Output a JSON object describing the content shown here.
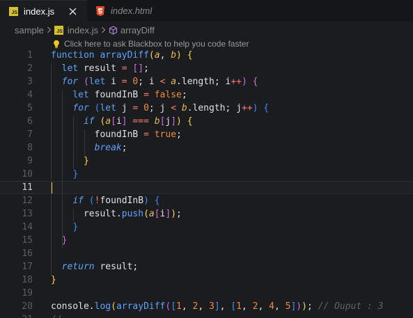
{
  "tabs": [
    {
      "label": "index.js",
      "badge": "JS",
      "active": true
    },
    {
      "label": "index.html",
      "badge": "HTML5",
      "active": false
    }
  ],
  "breadcrumb": [
    "sample",
    "index.js",
    "arrayDiff"
  ],
  "hint": {
    "text": "Click here to ask Blackbox to help you code faster"
  },
  "editor": {
    "current_line": 11,
    "lines": [
      {
        "n": "1",
        "tokens": [
          [
            "kw",
            "function "
          ],
          [
            "fn",
            "arrayDiff"
          ],
          [
            "br1",
            "("
          ],
          [
            "par",
            "a"
          ],
          [
            "plain",
            ", "
          ],
          [
            "par",
            "b"
          ],
          [
            "br1",
            ")"
          ],
          [
            "plain",
            " "
          ],
          [
            "br1",
            "{"
          ]
        ]
      },
      {
        "n": "2",
        "tokens": [
          [
            "plain",
            "  "
          ],
          [
            "kw",
            "let "
          ],
          [
            "plain",
            "result "
          ],
          [
            "op",
            "="
          ],
          [
            "plain",
            " "
          ],
          [
            "br2",
            "[]"
          ],
          [
            "plain",
            ";"
          ]
        ]
      },
      {
        "n": "3",
        "tokens": [
          [
            "plain",
            "  "
          ],
          [
            "kwi",
            "for"
          ],
          [
            "plain",
            " "
          ],
          [
            "br2",
            "("
          ],
          [
            "kw",
            "let "
          ],
          [
            "plain",
            "i "
          ],
          [
            "op",
            "="
          ],
          [
            "plain",
            " "
          ],
          [
            "num",
            "0"
          ],
          [
            "plain",
            "; i "
          ],
          [
            "op",
            "<"
          ],
          [
            "plain",
            " "
          ],
          [
            "par",
            "a"
          ],
          [
            "plain",
            ".length; i"
          ],
          [
            "op",
            "++"
          ],
          [
            "br2",
            ")"
          ],
          [
            "plain",
            " "
          ],
          [
            "br2",
            "{"
          ]
        ]
      },
      {
        "n": "4",
        "tokens": [
          [
            "plain",
            "    "
          ],
          [
            "kw",
            "let "
          ],
          [
            "plain",
            "foundInB "
          ],
          [
            "op",
            "="
          ],
          [
            "plain",
            " "
          ],
          [
            "bool",
            "false"
          ],
          [
            "plain",
            ";"
          ]
        ]
      },
      {
        "n": "5",
        "tokens": [
          [
            "plain",
            "    "
          ],
          [
            "kwi",
            "for"
          ],
          [
            "plain",
            " "
          ],
          [
            "br3",
            "("
          ],
          [
            "kw",
            "let "
          ],
          [
            "plain",
            "j "
          ],
          [
            "op",
            "="
          ],
          [
            "plain",
            " "
          ],
          [
            "num",
            "0"
          ],
          [
            "plain",
            "; j "
          ],
          [
            "op",
            "<"
          ],
          [
            "plain",
            " "
          ],
          [
            "par",
            "b"
          ],
          [
            "plain",
            ".length; j"
          ],
          [
            "op",
            "++"
          ],
          [
            "br3",
            ")"
          ],
          [
            "plain",
            " "
          ],
          [
            "br3",
            "{"
          ]
        ]
      },
      {
        "n": "6",
        "tokens": [
          [
            "plain",
            "      "
          ],
          [
            "kwi",
            "if"
          ],
          [
            "plain",
            " "
          ],
          [
            "br1",
            "("
          ],
          [
            "par",
            "a"
          ],
          [
            "br2",
            "["
          ],
          [
            "plain",
            "i"
          ],
          [
            "br2",
            "]"
          ],
          [
            "plain",
            " "
          ],
          [
            "op",
            "==="
          ],
          [
            "plain",
            " "
          ],
          [
            "par",
            "b"
          ],
          [
            "br2",
            "["
          ],
          [
            "plain",
            "j"
          ],
          [
            "br2",
            "]"
          ],
          [
            "br1",
            ")"
          ],
          [
            "plain",
            " "
          ],
          [
            "br1",
            "{"
          ]
        ]
      },
      {
        "n": "7",
        "tokens": [
          [
            "plain",
            "        foundInB "
          ],
          [
            "op",
            "="
          ],
          [
            "plain",
            " "
          ],
          [
            "bool",
            "true"
          ],
          [
            "plain",
            ";"
          ]
        ]
      },
      {
        "n": "8",
        "tokens": [
          [
            "plain",
            "        "
          ],
          [
            "kwi",
            "break"
          ],
          [
            "plain",
            ";"
          ]
        ]
      },
      {
        "n": "9",
        "tokens": [
          [
            "plain",
            "      "
          ],
          [
            "br1",
            "}"
          ]
        ]
      },
      {
        "n": "10",
        "tokens": [
          [
            "plain",
            "    "
          ],
          [
            "br3",
            "}"
          ]
        ]
      },
      {
        "n": "11",
        "tokens": []
      },
      {
        "n": "12",
        "tokens": [
          [
            "plain",
            "    "
          ],
          [
            "kwi",
            "if"
          ],
          [
            "plain",
            " "
          ],
          [
            "br3",
            "("
          ],
          [
            "op",
            "!"
          ],
          [
            "plain",
            "foundInB"
          ],
          [
            "br3",
            ")"
          ],
          [
            "plain",
            " "
          ],
          [
            "br3",
            "{"
          ]
        ]
      },
      {
        "n": "13",
        "tokens": [
          [
            "plain",
            "      result."
          ],
          [
            "fn",
            "push"
          ],
          [
            "br1",
            "("
          ],
          [
            "par",
            "a"
          ],
          [
            "br2",
            "["
          ],
          [
            "plain",
            "i"
          ],
          [
            "br2",
            "]"
          ],
          [
            "br1",
            ")"
          ],
          [
            "plain",
            ";"
          ]
        ]
      },
      {
        "n": "14",
        "tokens": [
          [
            "plain",
            "    "
          ],
          [
            "br3",
            "}"
          ]
        ]
      },
      {
        "n": "15",
        "tokens": [
          [
            "plain",
            "  "
          ],
          [
            "br2",
            "}"
          ]
        ]
      },
      {
        "n": "16",
        "tokens": []
      },
      {
        "n": "17",
        "tokens": [
          [
            "plain",
            "  "
          ],
          [
            "kwi",
            "return"
          ],
          [
            "plain",
            " result;"
          ]
        ]
      },
      {
        "n": "18",
        "tokens": [
          [
            "br1",
            "}"
          ]
        ]
      },
      {
        "n": "19",
        "tokens": []
      },
      {
        "n": "20",
        "tokens": [
          [
            "plain",
            "console."
          ],
          [
            "fn",
            "log"
          ],
          [
            "br1",
            "("
          ],
          [
            "fn",
            "arrayDiff"
          ],
          [
            "br2",
            "("
          ],
          [
            "br3",
            "["
          ],
          [
            "num",
            "1"
          ],
          [
            "plain",
            ", "
          ],
          [
            "num",
            "2"
          ],
          [
            "plain",
            ", "
          ],
          [
            "num",
            "3"
          ],
          [
            "br3",
            "]"
          ],
          [
            "plain",
            ", "
          ],
          [
            "br3",
            "["
          ],
          [
            "num",
            "1"
          ],
          [
            "plain",
            ", "
          ],
          [
            "num",
            "2"
          ],
          [
            "plain",
            ", "
          ],
          [
            "num",
            "4"
          ],
          [
            "plain",
            ", "
          ],
          [
            "num",
            "5"
          ],
          [
            "br3",
            "]"
          ],
          [
            "br2",
            ")"
          ],
          [
            "br1",
            ")"
          ],
          [
            "plain",
            "; "
          ],
          [
            "cmt",
            "// Ouput : 3"
          ]
        ]
      },
      {
        "n": "21",
        "tokens": [
          [
            "cmt",
            "// "
          ]
        ]
      }
    ]
  },
  "colors": {
    "background": "#1b1c1e",
    "keyword": "#5aa3ff",
    "number": "#f08a3e",
    "operator": "#ff7b72",
    "cursor": "#f2c94c"
  }
}
